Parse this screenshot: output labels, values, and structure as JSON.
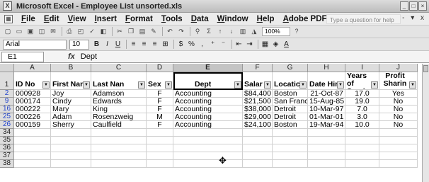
{
  "window": {
    "title": "Microsoft Excel - Employee List unsorted.xls",
    "app_icon": "X",
    "controls": [
      "_",
      "□",
      "×"
    ]
  },
  "menubar": {
    "items": [
      "File",
      "Edit",
      "View",
      "Insert",
      "Format",
      "Tools",
      "Data",
      "Window",
      "Help",
      "Adobe PDF"
    ],
    "help_placeholder": "Type a question for help",
    "right_icons": "- ▾ x"
  },
  "standard_toolbar": {
    "zoom": "100%"
  },
  "formatting_toolbar": {
    "font": "Arial",
    "size": "10"
  },
  "formula_bar": {
    "name_box": "E1",
    "fx": "fx",
    "content": "Dept"
  },
  "grid": {
    "columns": [
      "A",
      "B",
      "C",
      "D",
      "E",
      "F",
      "G",
      "H",
      "I",
      "J"
    ],
    "active_column": "E",
    "header_row_number": "1",
    "headers": [
      "ID No",
      "First Nan",
      "Last Nan",
      "Sex",
      "Dept",
      "Salar",
      "Locatic",
      "Date Hir",
      "Years of Servic",
      "Profit Sharin"
    ],
    "rows": [
      {
        "num": "2",
        "cells": [
          "000928",
          "Joy",
          "Adamson",
          "F",
          "Accounting",
          "$84,400",
          "Boston",
          "21-Oct-87",
          "17.0",
          "Yes"
        ]
      },
      {
        "num": "9",
        "cells": [
          "000174",
          "Cindy",
          "Edwards",
          "F",
          "Accounting",
          "$21,500",
          "San Franc",
          "15-Aug-85",
          "19.0",
          "No"
        ]
      },
      {
        "num": "16",
        "cells": [
          "000222",
          "Mary",
          "King",
          "F",
          "Accounting",
          "$38,000",
          "Detroit",
          "10-Mar-97",
          "7.0",
          "No"
        ]
      },
      {
        "num": "25",
        "cells": [
          "000226",
          "Adam",
          "Rosenzweig",
          "M",
          "Accounting",
          "$29,000",
          "Detroit",
          "01-Mar-01",
          "3.0",
          "No"
        ]
      },
      {
        "num": "26",
        "cells": [
          "000159",
          "Sherry",
          "Caulfield",
          "F",
          "Accounting",
          "$24,100",
          "Boston",
          "19-Mar-94",
          "10.0",
          "No"
        ]
      }
    ],
    "empty_rows": [
      "34",
      "35",
      "36",
      "37",
      "38"
    ]
  }
}
